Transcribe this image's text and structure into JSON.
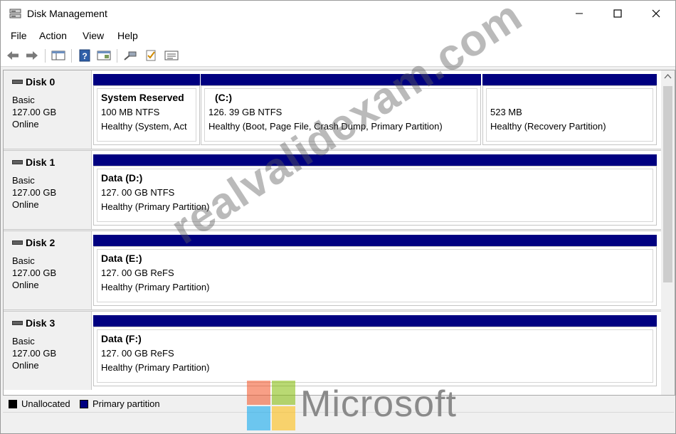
{
  "window": {
    "title": "Disk Management"
  },
  "menu": [
    "File",
    "Action",
    "View",
    "Help"
  ],
  "toolbar_icons": [
    "back-arrow-icon",
    "forward-arrow-icon",
    "console-tree-icon",
    "help-icon",
    "properties-icon",
    "connect-icon",
    "check-icon",
    "list-view-icon"
  ],
  "disks": [
    {
      "name": "Disk 0",
      "type": "Basic",
      "size": "127.00 GB",
      "status": "Online",
      "partitions": [
        {
          "name": "System Reserved",
          "size": "100 MB NTFS",
          "status": "Healthy (System, Act"
        },
        {
          "name": "(C:)",
          "size": "126. 39 GB NTFS",
          "status": "Healthy (Boot, Page File, Crash Dump, Primary Partition)"
        },
        {
          "name": "",
          "size": "523 MB",
          "status": "Healthy (Recovery Partition)"
        }
      ]
    },
    {
      "name": "Disk 1",
      "type": "Basic",
      "size": "127.00 GB",
      "status": "Online",
      "partitions": [
        {
          "name": "Data (D:)",
          "size": "127. 00 GB NTFS",
          "status": "Healthy (Primary Partition)"
        }
      ]
    },
    {
      "name": "Disk 2",
      "type": "Basic",
      "size": "127.00 GB",
      "status": "Online",
      "partitions": [
        {
          "name": "Data (E:)",
          "size": "127. 00 GB ReFS",
          "status": "Healthy (Primary Partition)"
        }
      ]
    },
    {
      "name": "Disk 3",
      "type": "Basic",
      "size": "127.00 GB",
      "status": "Online",
      "partitions": [
        {
          "name": "Data (F:)",
          "size": "127. 00 GB ReFS",
          "status": "Healthy (Primary Partition)"
        }
      ]
    }
  ],
  "legend": [
    {
      "label": "Unallocated",
      "color": "#000000"
    },
    {
      "label": "Primary partition",
      "color": "#000080"
    }
  ],
  "watermark": "realvalidexam.com",
  "brand": {
    "text": "Microsoft",
    "colors": [
      "#f25022",
      "#7fba00",
      "#00a4ef",
      "#ffb900"
    ]
  }
}
